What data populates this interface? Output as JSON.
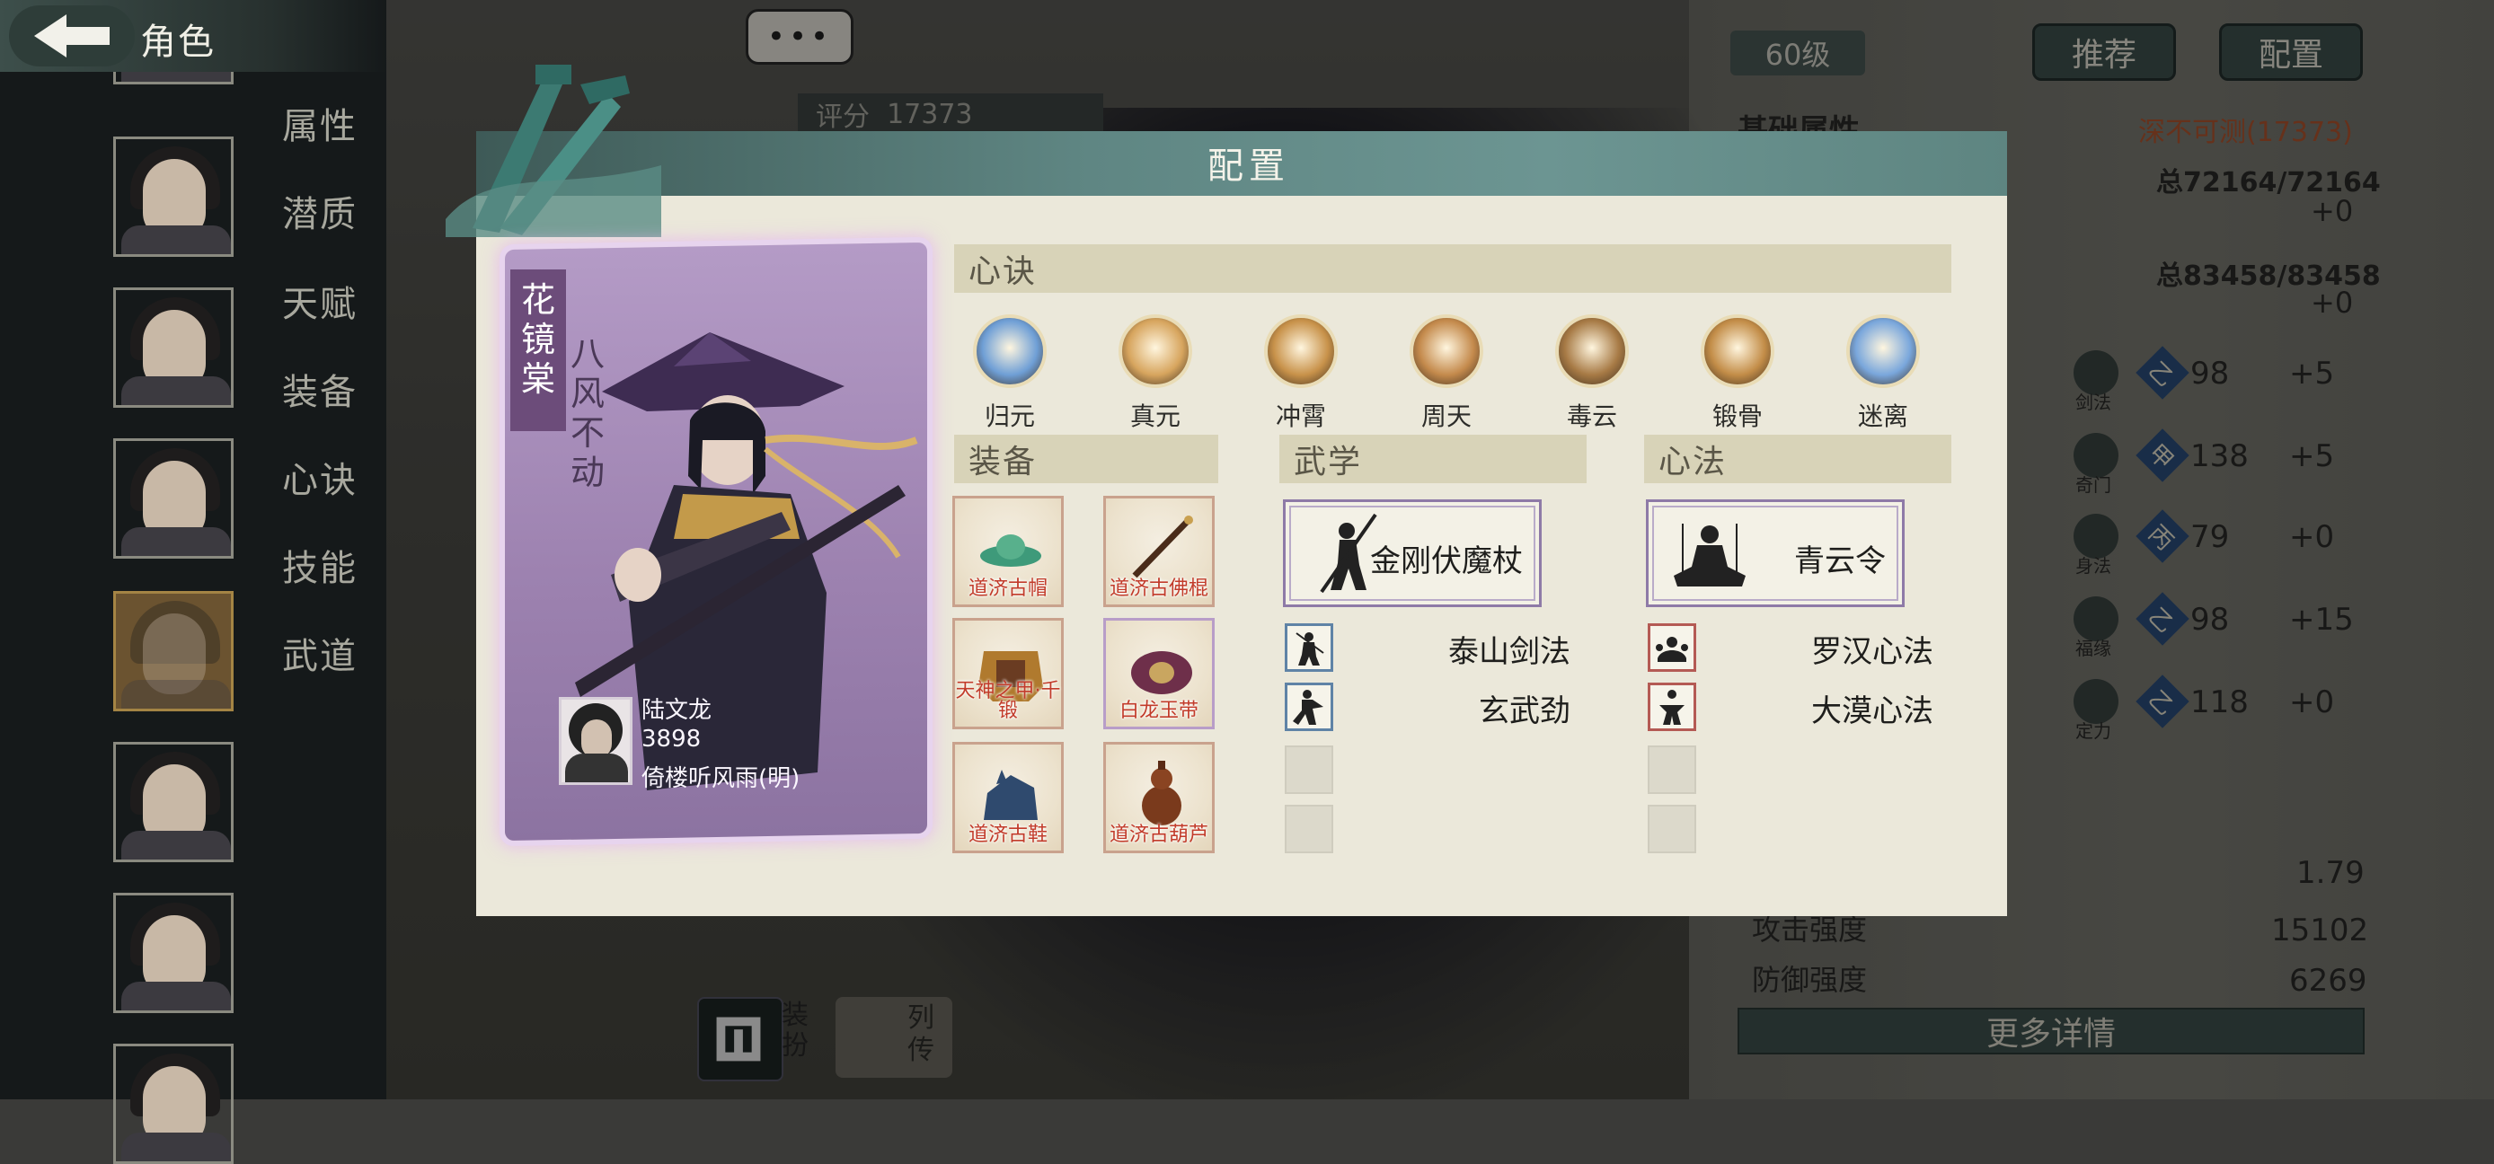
{
  "topbar": {
    "title": "角色"
  },
  "sidebar": {
    "menu": [
      "属性",
      "潜质",
      "天赋",
      "装备",
      "心诀",
      "技能",
      "武道"
    ]
  },
  "background": {
    "chat_button": "•••",
    "score_label": "评分",
    "score_value": "17373",
    "level": "60级",
    "recommend_button": "推荐",
    "config_button": "配置",
    "basic_attr_label": "基础属性",
    "basic_attr_value": "深不可测(17373)",
    "hp_total": "总72164/72164",
    "hp_delta": "+0",
    "mp_total": "总83458/83458",
    "mp_delta": "+0",
    "stats": [
      {
        "name": "剑法",
        "grade": "乙",
        "value": "98",
        "delta": "+5"
      },
      {
        "name": "奇门",
        "grade": "甲",
        "value": "138",
        "delta": "+5"
      },
      {
        "name": "身法",
        "grade": "丙",
        "value": "79",
        "delta": "+0"
      },
      {
        "name": "福缘",
        "grade": "乙",
        "value": "98",
        "delta": "+15"
      },
      {
        "name": "定力",
        "grade": "乙",
        "value": "118",
        "delta": "+0"
      }
    ],
    "rate_value": "1.79",
    "attack_label": "攻击强度",
    "attack_value": "15102",
    "defense_label": "防御强度",
    "defense_value": "6269",
    "more_details": "更多详情",
    "dress_label": "装扮",
    "bio_label": "列传"
  },
  "modal": {
    "title": "配置",
    "card": {
      "name": "花镜棠",
      "title": "八风不动",
      "player_name": "陆文龙",
      "player_power": "3898",
      "player_server": "倚楼听风雨(明)"
    },
    "xinjue_header": "心诀",
    "xinjue": [
      {
        "label": "归元",
        "color": "#6f9fd6"
      },
      {
        "label": "真元",
        "color": "#d7a55e"
      },
      {
        "label": "冲霄",
        "color": "#c8924a"
      },
      {
        "label": "周天",
        "color": "#c48a4c"
      },
      {
        "label": "毒云",
        "color": "#a77a45"
      },
      {
        "label": "锻骨",
        "color": "#c38d48"
      },
      {
        "label": "迷离",
        "color": "#7aa7dc"
      }
    ],
    "equip_header": "装备",
    "equipment": [
      {
        "label": "道济古帽",
        "rarity": "red"
      },
      {
        "label": "道济古佛棍",
        "rarity": "red"
      },
      {
        "label": "天神之甲·千锻",
        "rarity": "red"
      },
      {
        "label": "白龙玉带",
        "rarity": "purple"
      },
      {
        "label": "道济古鞋",
        "rarity": "red"
      },
      {
        "label": "道济古葫芦",
        "rarity": "red"
      }
    ],
    "wuxue_header": "武学",
    "wuxue_main": "金刚伏魔杖",
    "wuxue_sub": [
      "泰山剑法",
      "玄武劲"
    ],
    "xinfa_header": "心法",
    "xinfa_main": "青云令",
    "xinfa_sub": [
      "罗汉心法",
      "大漠心法"
    ]
  }
}
